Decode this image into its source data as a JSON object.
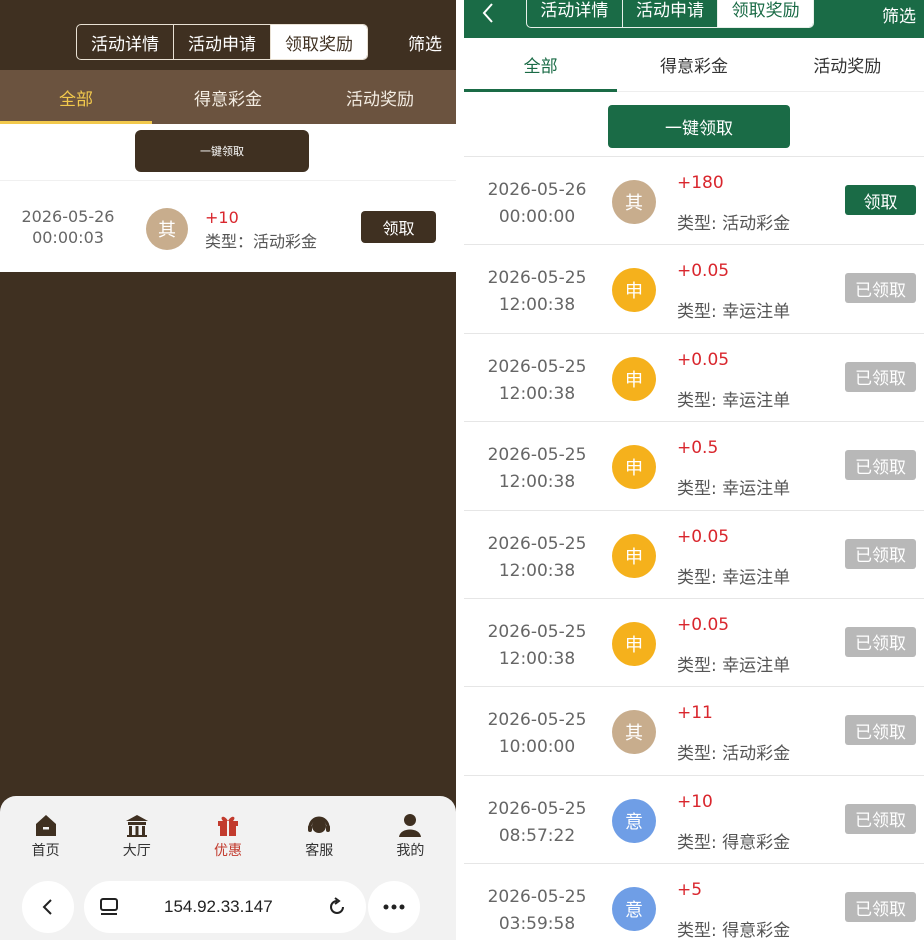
{
  "colors": {
    "left_brand": "#3f3021",
    "left_tab_bg": "#6b533f",
    "left_tab_active": "#f2c94c",
    "right_brand": "#1a6b46",
    "amount": "#d9262d",
    "claimed_gray": "#b8b8b8",
    "avatar_other": "#c8ad8d",
    "avatar_apply": "#f5b11c",
    "avatar_deyi": "#6f9ee6"
  },
  "left": {
    "segments": [
      "活动详情",
      "活动申请",
      "领取奖励"
    ],
    "filter_label": "筛选",
    "tabs": [
      "全部",
      "得意彩金",
      "活动奖励"
    ],
    "one_key_claim": "一键领取",
    "record": {
      "date": "2026-05-26",
      "time": "00:00:03",
      "avatar": "其",
      "amount": "+10",
      "type": "类型：活动彩金",
      "action": "领取"
    },
    "nav": [
      "首页",
      "大厅",
      "优惠",
      "客服",
      "我的"
    ],
    "browser": {
      "url": "154.92.33.147"
    }
  },
  "right": {
    "segments": [
      "活动详情",
      "活动申请",
      "领取奖励"
    ],
    "filter_label": "筛选",
    "tabs": [
      "全部",
      "得意彩金",
      "活动奖励"
    ],
    "one_key_claim": "一键领取",
    "records": [
      {
        "date": "2026-05-26",
        "time": "00:00:00",
        "avatar": "其",
        "avatar_kind": "other",
        "amount": "+180",
        "type": "类型: 活动彩金",
        "action": "领取",
        "claimed": false
      },
      {
        "date": "2026-05-25",
        "time": "12:00:38",
        "avatar": "申",
        "avatar_kind": "apply",
        "amount": "+0.05",
        "type": "类型: 幸运注单",
        "action": "已领取",
        "claimed": true
      },
      {
        "date": "2026-05-25",
        "time": "12:00:38",
        "avatar": "申",
        "avatar_kind": "apply",
        "amount": "+0.05",
        "type": "类型: 幸运注单",
        "action": "已领取",
        "claimed": true
      },
      {
        "date": "2026-05-25",
        "time": "12:00:38",
        "avatar": "申",
        "avatar_kind": "apply",
        "amount": "+0.5",
        "type": "类型: 幸运注单",
        "action": "已领取",
        "claimed": true
      },
      {
        "date": "2026-05-25",
        "time": "12:00:38",
        "avatar": "申",
        "avatar_kind": "apply",
        "amount": "+0.05",
        "type": "类型: 幸运注单",
        "action": "已领取",
        "claimed": true
      },
      {
        "date": "2026-05-25",
        "time": "12:00:38",
        "avatar": "申",
        "avatar_kind": "apply",
        "amount": "+0.05",
        "type": "类型: 幸运注单",
        "action": "已领取",
        "claimed": true
      },
      {
        "date": "2026-05-25",
        "time": "10:00:00",
        "avatar": "其",
        "avatar_kind": "other",
        "amount": "+11",
        "type": "类型: 活动彩金",
        "action": "已领取",
        "claimed": true
      },
      {
        "date": "2026-05-25",
        "time": "08:57:22",
        "avatar": "意",
        "avatar_kind": "deyi",
        "amount": "+10",
        "type": "类型: 得意彩金",
        "action": "已领取",
        "claimed": true
      },
      {
        "date": "2026-05-25",
        "time": "03:59:58",
        "avatar": "意",
        "avatar_kind": "deyi",
        "amount": "+5",
        "type": "类型: 得意彩金",
        "action": "已领取",
        "claimed": true
      }
    ]
  }
}
